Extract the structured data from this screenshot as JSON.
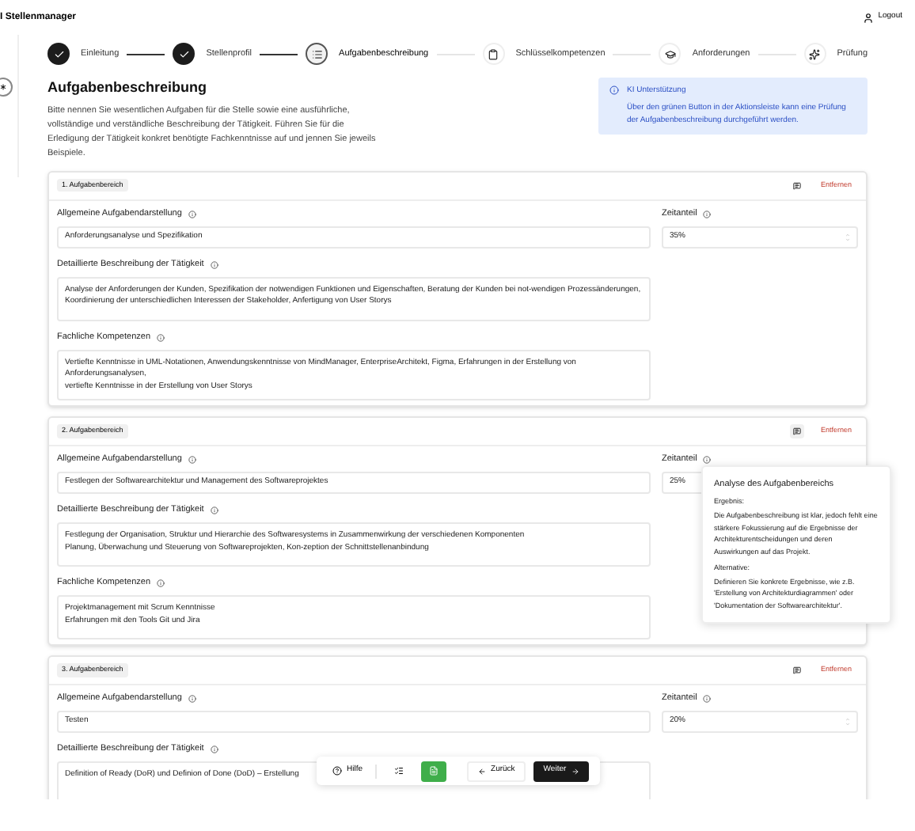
{
  "header": {
    "app_title": "I Stellenmanager",
    "logout": "Logout"
  },
  "steps": [
    {
      "label": "Einleitung",
      "completed": true,
      "selected": false
    },
    {
      "label": "Stellenprofil",
      "completed": true,
      "selected": false
    },
    {
      "label": "Aufgabenbeschreibung",
      "completed": false,
      "selected": true
    },
    {
      "label": "Schlüsselkompetenzen",
      "completed": false,
      "selected": false
    },
    {
      "label": "Anforderungen",
      "completed": false,
      "selected": false
    },
    {
      "label": "Prüfung",
      "completed": false,
      "selected": false
    }
  ],
  "intro": {
    "title": "Aufgabenbeschreibung",
    "text": "Bitte nennen Sie wesentlichen Aufgaben für die Stelle sowie eine ausführliche, vollständige und verständliche Beschreibung der Tätigkeit. Führen Sie für die Erledigung der Tätigkeit konkret benötigte Fachkenntnisse auf und jennen Sie jeweils Beispiele."
  },
  "info": {
    "title": "KI Unterstützung",
    "text": "Über den grünen Button in der Aktionsleiste kann eine Prüfung der Aufgabenbeschreibung durchgeführt werden."
  },
  "areas": [
    {
      "label": "1. Aufgabenbereich",
      "remove": "Entfernen",
      "general_label": "Allgemeine Aufgabendarstellung",
      "general": "Anforderungsanalyse und Spezifikation",
      "time_label": "Zeitanteil",
      "time": "35%",
      "detail_label": "Detaillierte Beschreibung der Tätigkeit",
      "detail": "Analyse der Anforderungen der Kunden, Spezifikation der notwendigen Funktionen und Eigenschaften, Beratung der Kunden bei not-wendigen Prozessänderungen, Koordinierung der unterschiedlichen Interessen der Stakeholder, Anfertigung von User Storys",
      "skills_label": "Fachliche Kompetenzen",
      "skills": "Vertiefte Kenntnisse in UML-Notationen, Anwendungskenntnisse von MindManager, EnterpriseArchitekt, Figma, Erfahrungen in der Erstellung von Anforderungsanalysen,\nvertiefte Kenntnisse in der Erstellung von User Storys"
    },
    {
      "label": "2. Aufgabenbereich",
      "remove": "Entfernen",
      "general_label": "Allgemeine Aufgabendarstellung",
      "general": "Festlegen der Softwarearchitektur und Management des Softwareprojektes",
      "time_label": "Zeitanteil",
      "time": "25%",
      "detail_label": "Detaillierte Beschreibung der Tätigkeit",
      "detail": "Festlegung der Organisation, Struktur und Hierarchie des Softwaresystems in Zusammenwirkung der verschiedenen Komponenten\nPlanung, Überwachung und Steuerung von Softwareprojekten, Kon-zeption der Schnittstellenanbindung",
      "skills_label": "Fachliche Kompetenzen",
      "skills": "Projektmanagement mit Scrum Kenntnisse\nErfahrungen mit den Tools Git und Jira"
    },
    {
      "label": "3. Aufgabenbereich",
      "remove": "Entfernen",
      "general_label": "Allgemeine Aufgabendarstellung",
      "general": "Testen",
      "time_label": "Zeitanteil",
      "time": "20%",
      "detail_label": "Detaillierte Beschreibung der Tätigkeit",
      "detail": "Definition of Ready (DoR) und Definion of Done (DoD) – Erstellung"
    }
  ],
  "popover": {
    "title": "Analyse des Aufgabenbereichs",
    "sections": [
      {
        "heading": "Ergebnis:",
        "text": "Die Aufgabenbeschreibung ist klar, jedoch fehlt eine stärkere Fokussierung auf die Ergebnisse der Architekturentscheidungen und deren Auswirkungen auf das Projekt."
      },
      {
        "heading": "Alternative:",
        "text": "Definieren Sie konkrete Ergebnisse, wie z.B. 'Erstellung von Architekturdiagrammen' oder 'Dokumentation der Softwarearchitektur'."
      }
    ]
  },
  "toolbar": {
    "help": "Hilfe",
    "back": "Zurück",
    "next": "Weiter"
  }
}
